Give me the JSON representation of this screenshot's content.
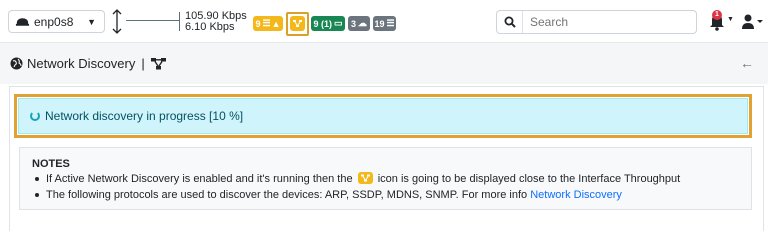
{
  "navbar": {
    "interface_name": "enp0s8",
    "throughput_upload": "105.90 Kbps",
    "throughput_download": "6.10 Kbps",
    "badges": {
      "alerts": "9",
      "devices": "9 (1)",
      "hosts": "3",
      "flows": "19"
    },
    "search_placeholder": "Search",
    "notifications_count": "1",
    "colors": {
      "warning": "#f5b81b",
      "success": "#198754",
      "secondary": "#6c757d",
      "highlight": "#e0a233"
    }
  },
  "page_header": {
    "title": "Network Discovery",
    "separator": "|"
  },
  "alert": {
    "text": "Network discovery in progress [10 %]",
    "progress_percent": 10
  },
  "notes": {
    "title": "NOTES",
    "item1_before": "If Active Network Discovery is enabled and it's running then the",
    "item1_after": "icon is going to be displayed close to the Interface Throughput",
    "item2_before": "The following protocols are used to discover the devices: ARP, SSDP, MDNS, SNMP. For more info",
    "item2_link": "Network Discovery"
  }
}
